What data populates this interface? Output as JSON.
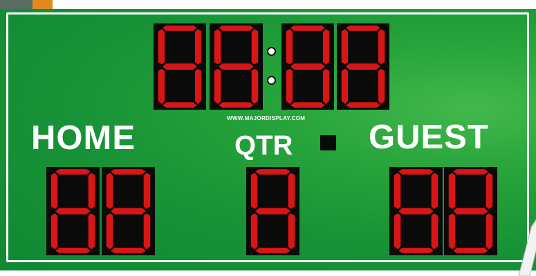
{
  "scoreboard": {
    "home_label": "HOME",
    "guest_label": "GUEST",
    "qtr_label": "QTR",
    "website": "WWW.MAJORDISPLAY.COM",
    "clock": {
      "digits": [
        "8",
        "8",
        "8",
        "8"
      ]
    },
    "home_score": {
      "digits": [
        "8",
        "8"
      ]
    },
    "quarter": {
      "digits": [
        "8"
      ]
    },
    "guest_score": {
      "digits": [
        "8",
        "8"
      ]
    }
  },
  "colors": {
    "board_green": "#179236",
    "segment_red": "#d81616",
    "digit_background": "#0a0a0a",
    "text": "#ffffff"
  },
  "icons": [
    "colon-dot-icon",
    "possession-indicator-icon"
  ]
}
